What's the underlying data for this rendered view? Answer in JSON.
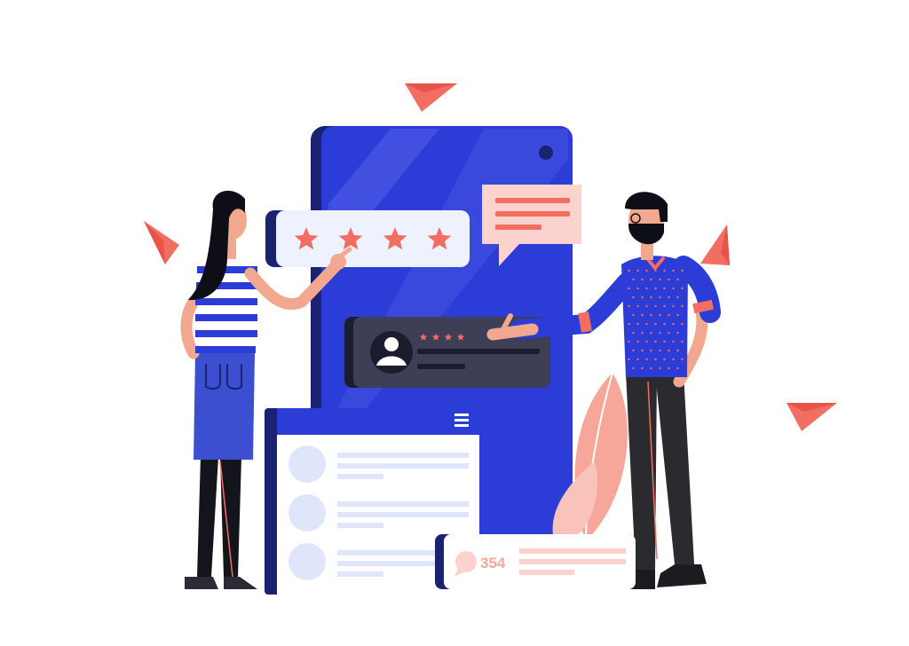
{
  "illustration": {
    "review_card": {
      "star_count": 4
    },
    "profile_card": {
      "star_count": 4
    },
    "counter_card": {
      "count": "354"
    },
    "palette": {
      "phone_blue": "#2c3cd6",
      "phone_dark": "#1a2370",
      "coral": "#f26d62",
      "light_blue": "#dfe6fb",
      "dark_card": "#3e3f57",
      "skirt_blue": "#3d4fd1"
    },
    "icons": [
      "paper-plane-icon",
      "star-icon",
      "user-avatar-icon",
      "chat-bubble-icon",
      "menu-icon",
      "comment-icon",
      "leaf-icon"
    ]
  }
}
